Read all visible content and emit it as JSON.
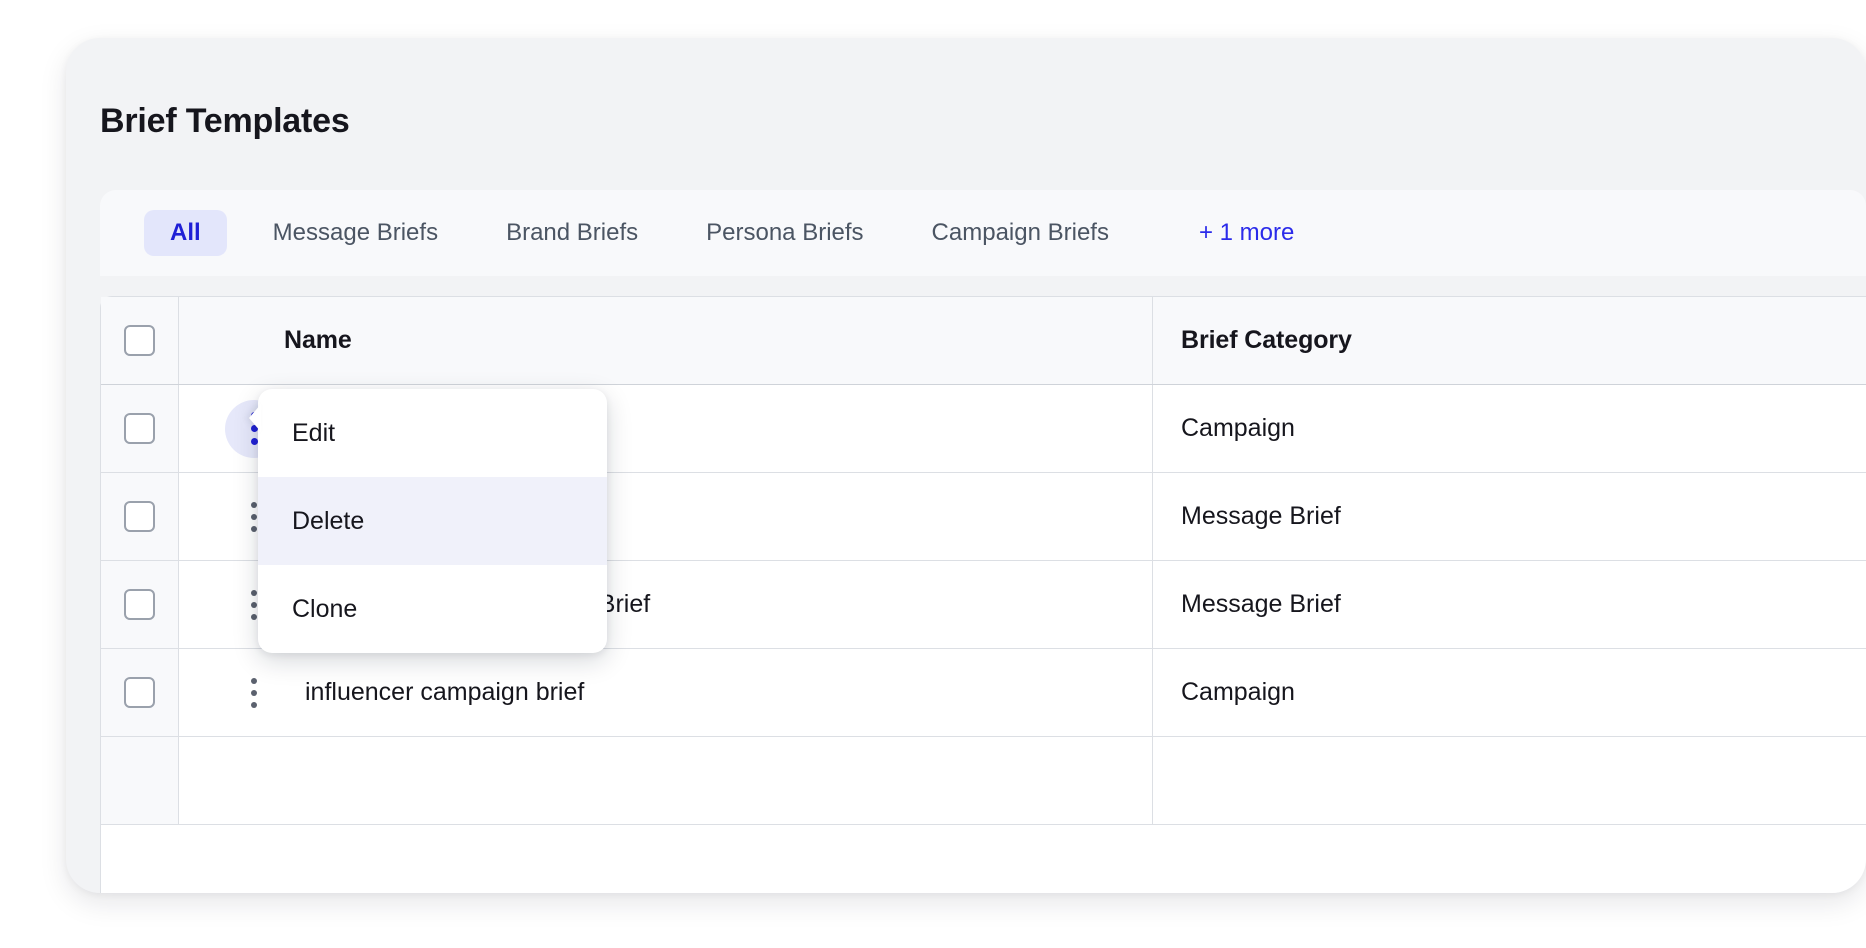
{
  "card": {
    "title": "Brief Templates"
  },
  "tabs": [
    {
      "label": "All",
      "active": true
    },
    {
      "label": "Message Briefs",
      "active": false
    },
    {
      "label": "Brand Briefs",
      "active": false
    },
    {
      "label": "Persona Briefs",
      "active": false
    },
    {
      "label": "Campaign Briefs",
      "active": false
    }
  ],
  "tabs_more": {
    "label": "+ 1 more"
  },
  "table": {
    "columns": [
      {
        "key": "select",
        "label": ""
      },
      {
        "key": "name",
        "label": "Name"
      },
      {
        "key": "brief_category",
        "label": "Brief Category"
      }
    ],
    "rows": [
      {
        "name": "",
        "brief_category": "Campaign",
        "menu_open": true,
        "name_occluded": true
      },
      {
        "name": "",
        "brief_category": "Message Brief",
        "menu_open": false,
        "name_occluded": true
      },
      {
        "name": "nt Brief",
        "brief_category": "Message Brief",
        "menu_open": false,
        "name_occluded": true
      },
      {
        "name": "influencer campaign brief",
        "brief_category": "Campaign",
        "menu_open": false,
        "name_occluded": false
      }
    ]
  },
  "context_menu": {
    "items": [
      {
        "label": "Edit",
        "highlighted": false
      },
      {
        "label": "Delete",
        "highlighted": true
      },
      {
        "label": "Clone",
        "highlighted": false
      }
    ]
  },
  "colors": {
    "page_background": "#ffffff",
    "card_background": "#f2f3f5",
    "tab_strip_background": "#f8f9fb",
    "active_tab_background": "#e3e6fb",
    "active_tab_text": "#1f1fd6",
    "more_link_text": "#2b2bea",
    "table_background": "#ffffff",
    "table_border": "#dcdfe4",
    "header_background": "#f8f9fb",
    "text_primary": "#16161d",
    "text_secondary": "#4b5563",
    "kebab_open_background": "#e6e8fa",
    "kebab_open_dots": "#2222d6",
    "kebab_dots": "#5b616e",
    "menu_highlight": "#f0f1fa"
  }
}
